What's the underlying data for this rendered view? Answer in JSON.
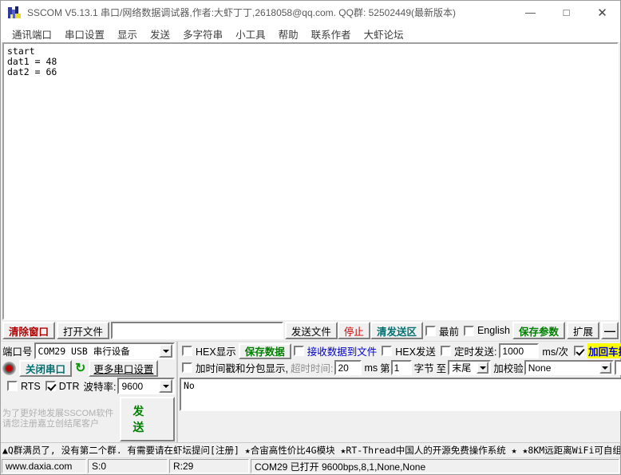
{
  "window": {
    "title": "SSCOM V5.13.1 串口/网络数据调试器,作者:大虾丁丁,2618058@qq.com. QQ群: 52502449(最新版本)",
    "minimize": "—",
    "maximize": "□",
    "close": "✕"
  },
  "menu": {
    "items": [
      {
        "label": "通讯端口"
      },
      {
        "label": "串口设置"
      },
      {
        "label": "显示"
      },
      {
        "label": "发送"
      },
      {
        "label": "多字符串"
      },
      {
        "label": "小工具"
      },
      {
        "label": "帮助"
      },
      {
        "label": "联系作者"
      },
      {
        "label": "大虾论坛"
      }
    ]
  },
  "receive": {
    "text": "start\ndat1 = 48\ndat2 = 66"
  },
  "toolbar": {
    "clear_window": "清除窗口",
    "open_file": "打开文件",
    "file_path": "",
    "send_file": "发送文件",
    "stop": "停止",
    "clear_send": "清发送区",
    "topmost_label": "最前",
    "topmost_checked": false,
    "english_label": "English",
    "english_checked": false,
    "save_params": "保存参数",
    "extend": "扩展",
    "collapse": "—"
  },
  "port_panel": {
    "port_label": "端口号",
    "port_value": "COM29 USB 串行设备",
    "close_port_button": "关闭串口",
    "refresh_icon": "↻",
    "more_settings": "更多串口设置",
    "rts_label": "RTS",
    "rts_checked": false,
    "dtr_label": "DTR",
    "dtr_checked": true,
    "baud_label": "波特率:",
    "baud_value": "9600",
    "promo_line1": "为了更好地发展SSCOM软件",
    "promo_line2": "请您注册嘉立创结尾客户",
    "send_button": "发 送"
  },
  "options": {
    "hex_display_label": "HEX显示",
    "hex_display_checked": false,
    "save_data_button": "保存数据",
    "recv_to_file_label": "接收数据到文件",
    "recv_to_file_checked": false,
    "hex_send_label": "HEX发送",
    "hex_send_checked": false,
    "timed_send_label": "定时发送:",
    "timed_send_checked": false,
    "timed_send_value": "1000",
    "ms_unit": "ms/次",
    "crlf_label": "加回车换行",
    "crlf_checked": true,
    "crlf_help": "?",
    "timestamp_label": "加时间戳和分包显示,",
    "timestamp_checked": false,
    "timeout_label": "超时时间:",
    "timeout_value": "20",
    "ms_label": "ms",
    "byte_from_label": "第",
    "byte_from_value": "1",
    "byte_label": "字节",
    "to_label": "至",
    "to_value": "末尾",
    "checksum_label": "加校验",
    "checksum_value": "None",
    "extra_value": ""
  },
  "send_area": {
    "text": "No"
  },
  "ticker": {
    "text": "▲Q群满员了, 没有第二个群. 有需要请在虾坛提问[注册] ★合宙高性价比4G模块 ★RT-Thread中国人的开源免费操作系统 ★ ★8KM远距离WiFi可自组"
  },
  "status": {
    "website": "www.daxia.com",
    "sent": "S:0",
    "received": "R:29",
    "connection": "COM29 已打开  9600bps,8,1,None,None"
  }
}
